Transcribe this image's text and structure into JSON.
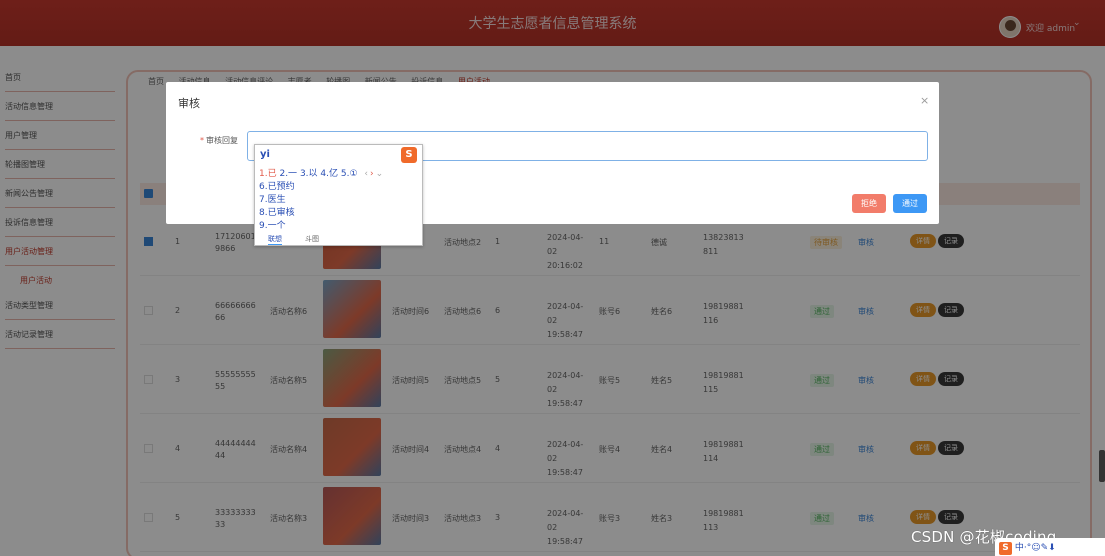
{
  "header": {
    "title": "大学生志愿者信息管理系统",
    "welcome": "欢迎 admin"
  },
  "sidebar": {
    "items": [
      "首页",
      "活动信息管理",
      "用户管理",
      "轮播图管理",
      "新闻公告管理",
      "投诉信息管理",
      "用户活动管理",
      "活动类型管理",
      "活动记录管理"
    ],
    "sub_item": "用户活动"
  },
  "tabs": [
    "首页",
    "活动信息",
    "活动信息评论",
    "志愿者",
    "轮播图",
    "新闻公告",
    "投诉信息",
    "用户活动"
  ],
  "table": {
    "rows": [
      {
        "index": "1",
        "id": "171206019866",
        "name": "",
        "time": "",
        "place": "活动地点2",
        "num": "1",
        "date": "2024-04-02 20:16:02",
        "account": "11",
        "uname": "德诚",
        "phone": "13823813811",
        "status": "待审核",
        "status_kind": "orange",
        "op": "审核",
        "checked": true
      },
      {
        "index": "2",
        "id": "6666666666",
        "name": "活动名称6",
        "time": "活动时间6",
        "place": "活动地点6",
        "num": "6",
        "date": "2024-04-02 19:58:47",
        "account": "账号6",
        "uname": "姓名6",
        "phone": "19819881116",
        "status": "通过",
        "status_kind": "green",
        "op": "审核",
        "checked": false
      },
      {
        "index": "3",
        "id": "5555555555",
        "name": "活动名称5",
        "time": "活动时间5",
        "place": "活动地点5",
        "num": "5",
        "date": "2024-04-02 19:58:47",
        "account": "账号5",
        "uname": "姓名5",
        "phone": "19819881115",
        "status": "通过",
        "status_kind": "green",
        "op": "审核",
        "checked": false
      },
      {
        "index": "4",
        "id": "4444444444",
        "name": "活动名称4",
        "time": "活动时间4",
        "place": "活动地点4",
        "num": "4",
        "date": "2024-04-02 19:58:47",
        "account": "账号4",
        "uname": "姓名4",
        "phone": "19819881114",
        "status": "通过",
        "status_kind": "green",
        "op": "审核",
        "checked": false
      },
      {
        "index": "5",
        "id": "3333333333",
        "name": "活动名称3",
        "time": "活动时间3",
        "place": "活动地点3",
        "num": "3",
        "date": "2024-04-02 19:58:47",
        "account": "账号3",
        "uname": "姓名3",
        "phone": "19819881113",
        "status": "通过",
        "status_kind": "green",
        "op": "审核",
        "checked": false
      }
    ],
    "detail_label": "详情",
    "record_label": "记录"
  },
  "dialog": {
    "title": "审核",
    "close_glyph": "×",
    "field_label": "审核回复",
    "field_value": "",
    "reject_label": "拒绝",
    "pass_label": "通过"
  },
  "ime": {
    "typed": "yi",
    "logo": "S",
    "first_line": [
      "1.已",
      "2.一",
      "3.以",
      "4.亿",
      "5.①"
    ],
    "candidates": [
      "6.已预约",
      "7.医生",
      "8.已审核",
      "9.一个"
    ],
    "footer_left": "联想",
    "footer_right": "斗图"
  },
  "watermark": "CSDN @花椒coding",
  "imebar_text": "中·°☺✎⬇",
  "colors": {
    "header": "#c0392b",
    "primary": "#3d98f5",
    "danger": "#f27c6a",
    "warning": "#e99a29"
  }
}
